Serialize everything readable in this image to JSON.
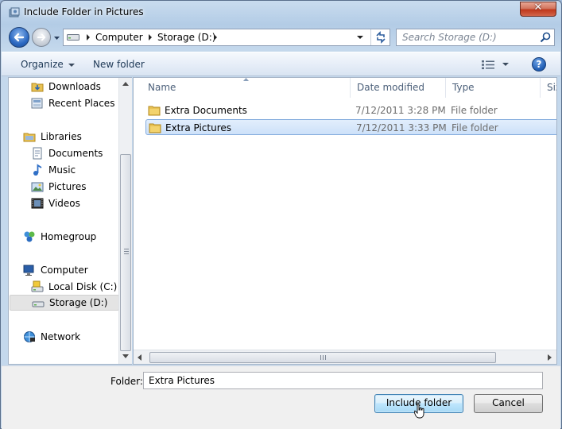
{
  "window": {
    "title": "Include Folder in Pictures",
    "close_glyph": "✕"
  },
  "address": {
    "crumbs": [
      "Computer",
      "Storage (D:)"
    ],
    "search_placeholder": "Search Storage (D:)"
  },
  "toolbar": {
    "organize": "Organize",
    "new_folder": "New folder",
    "help_glyph": "?"
  },
  "nav": {
    "items": [
      {
        "label": "Downloads",
        "icon": "downloads-icon"
      },
      {
        "label": "Recent Places",
        "icon": "recent-places-icon"
      },
      {
        "label": "Libraries",
        "icon": "libraries-icon"
      },
      {
        "label": "Documents",
        "icon": "documents-icon"
      },
      {
        "label": "Music",
        "icon": "music-icon"
      },
      {
        "label": "Pictures",
        "icon": "pictures-icon"
      },
      {
        "label": "Videos",
        "icon": "videos-icon"
      },
      {
        "label": "Homegroup",
        "icon": "homegroup-icon"
      },
      {
        "label": "Computer",
        "icon": "computer-icon"
      },
      {
        "label": "Local Disk (C:)",
        "icon": "local-disk-icon"
      },
      {
        "label": "Storage (D:)",
        "icon": "drive-icon",
        "selected": true
      },
      {
        "label": "Network",
        "icon": "network-icon"
      }
    ]
  },
  "files": {
    "columns": [
      "Name",
      "Date modified",
      "Type",
      "Size"
    ],
    "rows": [
      {
        "name": "Extra Documents",
        "date": "7/12/2011 3:28 PM",
        "type": "File folder",
        "selected": false
      },
      {
        "name": "Extra Pictures",
        "date": "7/12/2011 3:33 PM",
        "type": "File folder",
        "selected": true
      }
    ]
  },
  "footer": {
    "folder_label": "Folder:",
    "folder_value": "Extra Pictures",
    "include_button": "Include folder",
    "cancel_button": "Cancel"
  },
  "colors": {
    "selection": "#cde1f9",
    "selection_border": "#84acdd",
    "close_button": "#c0381c"
  }
}
